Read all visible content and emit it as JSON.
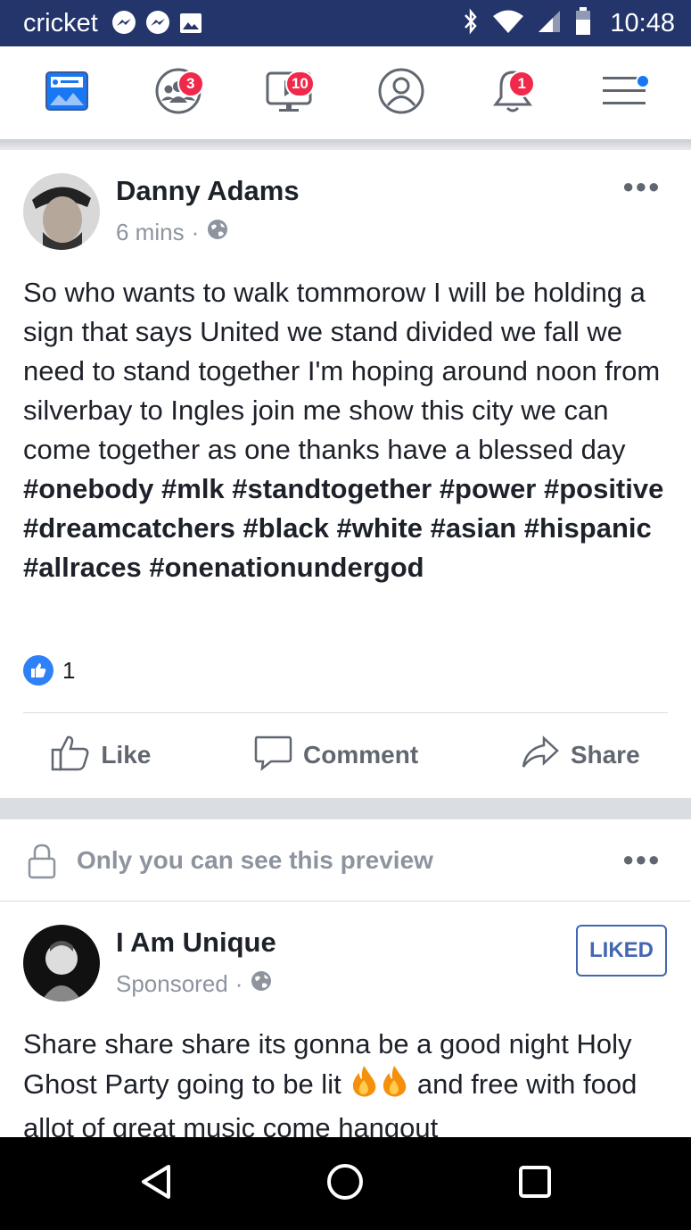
{
  "status_bar": {
    "carrier": "cricket",
    "time": "10:48"
  },
  "nav": {
    "items": [
      {
        "name": "news-feed",
        "icon": "news-feed-icon",
        "badge": ""
      },
      {
        "name": "friends",
        "icon": "friends-icon",
        "badge": "3"
      },
      {
        "name": "watch",
        "icon": "watch-icon",
        "badge": "10"
      },
      {
        "name": "profile",
        "icon": "profile-icon",
        "badge": ""
      },
      {
        "name": "notifications",
        "icon": "bell-icon",
        "badge": "1"
      },
      {
        "name": "menu",
        "icon": "menu-icon",
        "badge": ""
      }
    ]
  },
  "post": {
    "author": "Danny Adams",
    "time": "6 mins",
    "body": "So who wants to walk tommorow I will be holding a sign that says United we stand divided we fall we need to stand together I'm hoping around noon from silverbay to Ingles join me show this city we can come together as one thanks have a blessed day ",
    "hashtags": "#onebody #mlk #standtogether #power #positive #dreamcatchers #black #white #asian #hispanic #allraces #onenationundergod",
    "like_count": "1",
    "actions": {
      "like": "Like",
      "comment": "Comment",
      "share": "Share"
    }
  },
  "preview_notice": "Only you can see this preview",
  "sponsored_post": {
    "author": "I Am Unique",
    "label": "Sponsored",
    "liked_button": "LIKED",
    "body_before_emoji": "Share share share its gonna be a good night Holy Ghost Party going to be lit ",
    "body_after_emoji": " and free with food allot of great music come hangout"
  },
  "colors": {
    "status_bar": "#23356a",
    "accent": "#1877f2",
    "badge": "#f02849",
    "liked_border": "#4267b2"
  }
}
